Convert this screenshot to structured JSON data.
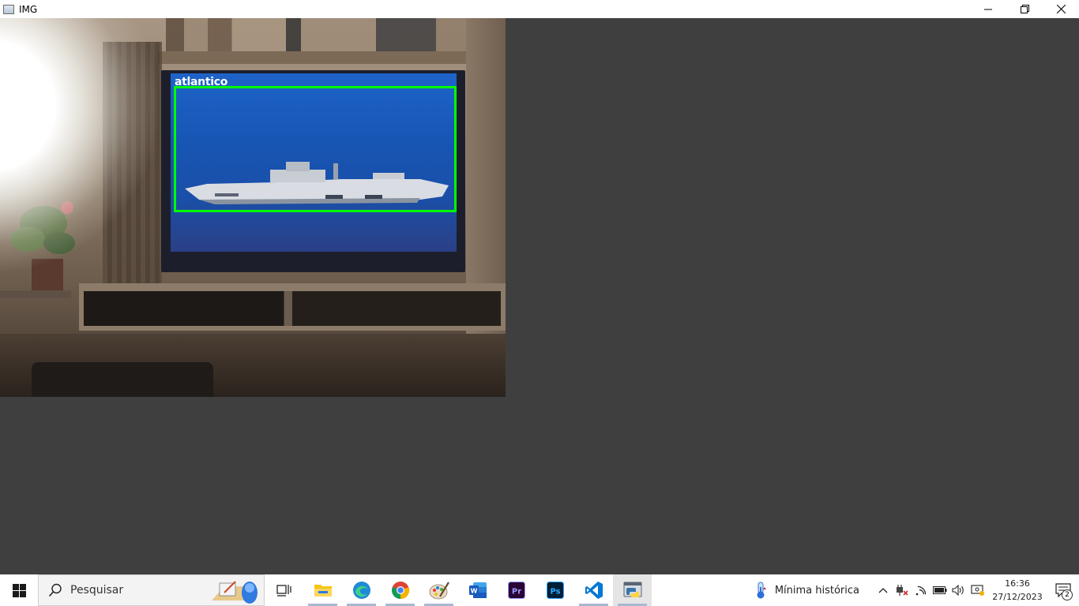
{
  "window": {
    "title": "IMG",
    "controls": [
      "minimize-icon",
      "restore-icon",
      "close-icon"
    ]
  },
  "detection": {
    "label": "atlantico",
    "box_color": "#00ff00"
  },
  "taskbar": {
    "search_placeholder": "Pesquisar",
    "apps": [
      {
        "name": "task-view-icon"
      },
      {
        "name": "file-explorer-icon"
      },
      {
        "name": "edge-icon"
      },
      {
        "name": "chrome-icon"
      },
      {
        "name": "paint-icon"
      },
      {
        "name": "word-icon"
      },
      {
        "name": "premiere-icon"
      },
      {
        "name": "photoshop-icon"
      },
      {
        "name": "vscode-icon"
      },
      {
        "name": "python-window-icon"
      }
    ],
    "weather_text": "Mínima histórica",
    "clock_time": "16:36",
    "clock_date": "27/12/2023",
    "notification_count": "2"
  },
  "colors": {
    "canvas_background": "#3f3f3f",
    "taskbar_background": "#ffffff"
  }
}
